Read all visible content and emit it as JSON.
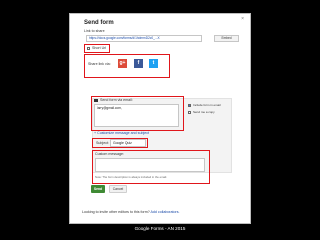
{
  "dialog": {
    "title": "Send form",
    "close": "×",
    "link_label": "Link to share",
    "link_value": "https://docs.google.com/forms/d/1hdmmD2c0_...X",
    "embed_label": "Embed",
    "short_url_label": "Short Url",
    "share_via_label": "Share link via:",
    "share_icons": [
      {
        "name": "google-plus",
        "glyph": "g+",
        "color": "#dd4b39"
      },
      {
        "name": "facebook",
        "glyph": "f",
        "color": "#3b5998"
      },
      {
        "name": "twitter",
        "glyph": "t",
        "color": "#1da1f2"
      }
    ],
    "send_via_email_label": "Send form via email:",
    "email_value": "larry@gmail.com,",
    "include_form_label": "Include form in email",
    "send_copy_label": "Send me a copy",
    "customize_label": "+ Customize message and subject",
    "subject_label": "Subject:",
    "subject_value": "Google Quiz",
    "custom_message_label": "Custom message:",
    "note_text": "Note: The form description is always included in the email.",
    "send_button": "Send",
    "cancel_button": "Cancel",
    "footer_text": "Looking to invite other editors to this form?",
    "footer_link": "Add collaborators."
  },
  "caption": "Google Forms - AN 2015",
  "colors": {
    "highlight": "#e0161b",
    "send_button": "#3f8a34",
    "background": "#000000"
  }
}
